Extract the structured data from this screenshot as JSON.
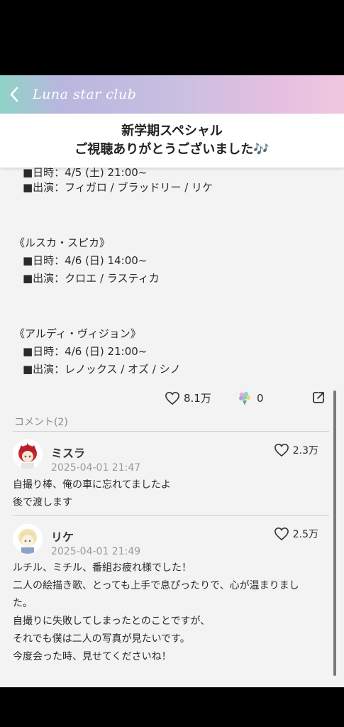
{
  "header": {
    "title": "Luna star club"
  },
  "banner": {
    "line1": "新学期スペシャル",
    "line2": "ご視聴ありがとうございました🎶"
  },
  "schedule": {
    "partial_date": "■日時：4/5 (土) 21:00~",
    "partial_cast": "■出演：フィガロ / ブラッドリー / リケ",
    "groups": [
      {
        "title": "《ルスカ・スピカ》",
        "date": "■日時：4/6 (日) 14:00~",
        "cast": "■出演：クロエ / ラスティカ"
      },
      {
        "title": "《アルディ・ヴィジョン》",
        "date": "■日時：4/6 (日) 21:00~",
        "cast": "■出演：レノックス / オズ / シノ"
      }
    ]
  },
  "actions": {
    "likes": "8.1万",
    "bouquets": "0"
  },
  "comments_label": "コメント(2)",
  "comments": [
    {
      "name": "ミスラ",
      "date": "2025-04-01 21:47",
      "likes": "2.3万",
      "lines": [
        "自撮り棒、俺の車に忘れてましたよ",
        "後で渡します"
      ]
    },
    {
      "name": "リケ",
      "date": "2025-04-01 21:49",
      "likes": "2.5万",
      "lines": [
        "ルチル、ミチル、番組お疲れ様でした！",
        "二人の絵描き歌、とっても上手で息ぴったりで、心が温まりまし",
        "た。",
        "自撮りに失敗してしまったとのことですが、",
        "それでも僕は二人の写真が見たいです。",
        "今度会った時、見せてくださいね！"
      ]
    }
  ]
}
